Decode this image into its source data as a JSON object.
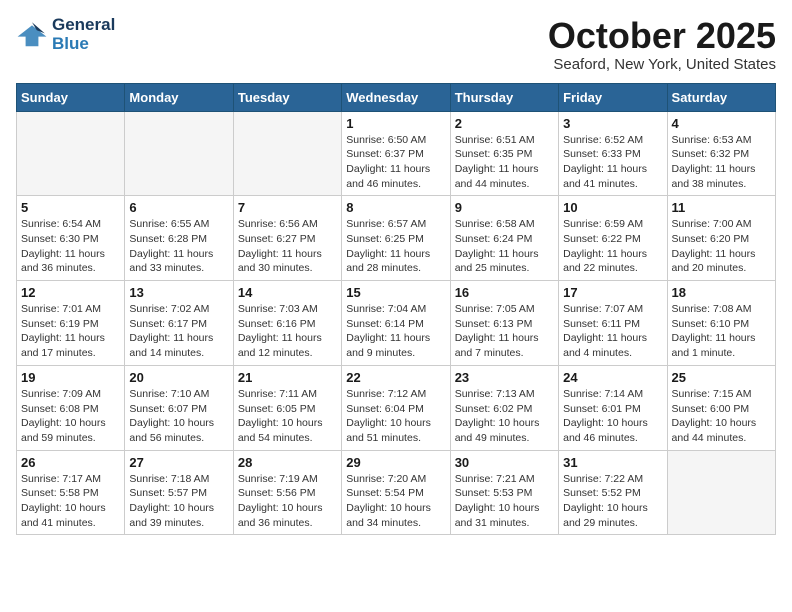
{
  "header": {
    "logo_general": "General",
    "logo_blue": "Blue",
    "month_title": "October 2025",
    "location": "Seaford, New York, United States"
  },
  "weekdays": [
    "Sunday",
    "Monday",
    "Tuesday",
    "Wednesday",
    "Thursday",
    "Friday",
    "Saturday"
  ],
  "weeks": [
    [
      {
        "day": "",
        "info": ""
      },
      {
        "day": "",
        "info": ""
      },
      {
        "day": "",
        "info": ""
      },
      {
        "day": "1",
        "info": "Sunrise: 6:50 AM\nSunset: 6:37 PM\nDaylight: 11 hours\nand 46 minutes."
      },
      {
        "day": "2",
        "info": "Sunrise: 6:51 AM\nSunset: 6:35 PM\nDaylight: 11 hours\nand 44 minutes."
      },
      {
        "day": "3",
        "info": "Sunrise: 6:52 AM\nSunset: 6:33 PM\nDaylight: 11 hours\nand 41 minutes."
      },
      {
        "day": "4",
        "info": "Sunrise: 6:53 AM\nSunset: 6:32 PM\nDaylight: 11 hours\nand 38 minutes."
      }
    ],
    [
      {
        "day": "5",
        "info": "Sunrise: 6:54 AM\nSunset: 6:30 PM\nDaylight: 11 hours\nand 36 minutes."
      },
      {
        "day": "6",
        "info": "Sunrise: 6:55 AM\nSunset: 6:28 PM\nDaylight: 11 hours\nand 33 minutes."
      },
      {
        "day": "7",
        "info": "Sunrise: 6:56 AM\nSunset: 6:27 PM\nDaylight: 11 hours\nand 30 minutes."
      },
      {
        "day": "8",
        "info": "Sunrise: 6:57 AM\nSunset: 6:25 PM\nDaylight: 11 hours\nand 28 minutes."
      },
      {
        "day": "9",
        "info": "Sunrise: 6:58 AM\nSunset: 6:24 PM\nDaylight: 11 hours\nand 25 minutes."
      },
      {
        "day": "10",
        "info": "Sunrise: 6:59 AM\nSunset: 6:22 PM\nDaylight: 11 hours\nand 22 minutes."
      },
      {
        "day": "11",
        "info": "Sunrise: 7:00 AM\nSunset: 6:20 PM\nDaylight: 11 hours\nand 20 minutes."
      }
    ],
    [
      {
        "day": "12",
        "info": "Sunrise: 7:01 AM\nSunset: 6:19 PM\nDaylight: 11 hours\nand 17 minutes."
      },
      {
        "day": "13",
        "info": "Sunrise: 7:02 AM\nSunset: 6:17 PM\nDaylight: 11 hours\nand 14 minutes."
      },
      {
        "day": "14",
        "info": "Sunrise: 7:03 AM\nSunset: 6:16 PM\nDaylight: 11 hours\nand 12 minutes."
      },
      {
        "day": "15",
        "info": "Sunrise: 7:04 AM\nSunset: 6:14 PM\nDaylight: 11 hours\nand 9 minutes."
      },
      {
        "day": "16",
        "info": "Sunrise: 7:05 AM\nSunset: 6:13 PM\nDaylight: 11 hours\nand 7 minutes."
      },
      {
        "day": "17",
        "info": "Sunrise: 7:07 AM\nSunset: 6:11 PM\nDaylight: 11 hours\nand 4 minutes."
      },
      {
        "day": "18",
        "info": "Sunrise: 7:08 AM\nSunset: 6:10 PM\nDaylight: 11 hours\nand 1 minute."
      }
    ],
    [
      {
        "day": "19",
        "info": "Sunrise: 7:09 AM\nSunset: 6:08 PM\nDaylight: 10 hours\nand 59 minutes."
      },
      {
        "day": "20",
        "info": "Sunrise: 7:10 AM\nSunset: 6:07 PM\nDaylight: 10 hours\nand 56 minutes."
      },
      {
        "day": "21",
        "info": "Sunrise: 7:11 AM\nSunset: 6:05 PM\nDaylight: 10 hours\nand 54 minutes."
      },
      {
        "day": "22",
        "info": "Sunrise: 7:12 AM\nSunset: 6:04 PM\nDaylight: 10 hours\nand 51 minutes."
      },
      {
        "day": "23",
        "info": "Sunrise: 7:13 AM\nSunset: 6:02 PM\nDaylight: 10 hours\nand 49 minutes."
      },
      {
        "day": "24",
        "info": "Sunrise: 7:14 AM\nSunset: 6:01 PM\nDaylight: 10 hours\nand 46 minutes."
      },
      {
        "day": "25",
        "info": "Sunrise: 7:15 AM\nSunset: 6:00 PM\nDaylight: 10 hours\nand 44 minutes."
      }
    ],
    [
      {
        "day": "26",
        "info": "Sunrise: 7:17 AM\nSunset: 5:58 PM\nDaylight: 10 hours\nand 41 minutes."
      },
      {
        "day": "27",
        "info": "Sunrise: 7:18 AM\nSunset: 5:57 PM\nDaylight: 10 hours\nand 39 minutes."
      },
      {
        "day": "28",
        "info": "Sunrise: 7:19 AM\nSunset: 5:56 PM\nDaylight: 10 hours\nand 36 minutes."
      },
      {
        "day": "29",
        "info": "Sunrise: 7:20 AM\nSunset: 5:54 PM\nDaylight: 10 hours\nand 34 minutes."
      },
      {
        "day": "30",
        "info": "Sunrise: 7:21 AM\nSunset: 5:53 PM\nDaylight: 10 hours\nand 31 minutes."
      },
      {
        "day": "31",
        "info": "Sunrise: 7:22 AM\nSunset: 5:52 PM\nDaylight: 10 hours\nand 29 minutes."
      },
      {
        "day": "",
        "info": ""
      }
    ]
  ]
}
